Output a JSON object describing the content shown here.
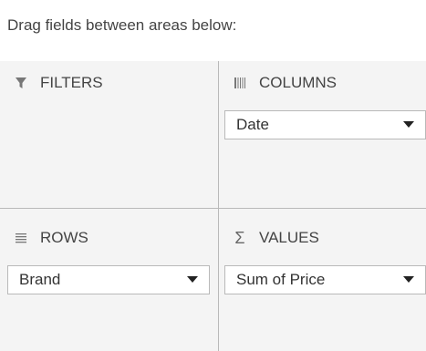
{
  "instruction": "Drag fields between areas below:",
  "areas": {
    "filters": {
      "label": "FILTERS",
      "icon": "filter-icon"
    },
    "columns": {
      "label": "COLUMNS",
      "icon": "columns-icon",
      "fields": [
        "Date"
      ]
    },
    "rows": {
      "label": "ROWS",
      "icon": "rows-icon",
      "fields": [
        "Brand"
      ]
    },
    "values": {
      "label": "VALUES",
      "icon": "sigma-icon",
      "icon_glyph": "Σ",
      "fields": [
        "Sum of Price"
      ]
    }
  },
  "colors": {
    "area_background": "#f4f4f4",
    "divider": "#b9b9b9",
    "text": "#444444",
    "chip_background": "#ffffff"
  }
}
